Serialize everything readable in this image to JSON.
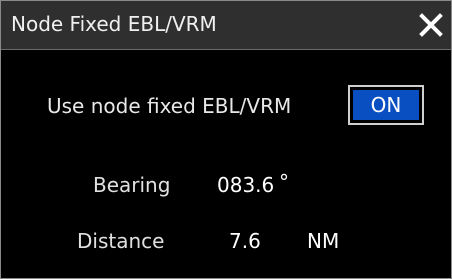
{
  "dialog": {
    "title": "Node Fixed EBL/VRM",
    "close_icon": "close-icon"
  },
  "option": {
    "label": "Use node fixed EBL/VRM",
    "toggle_label": "ON",
    "toggle_color": "#0a4fc2"
  },
  "bearing": {
    "label": "Bearing",
    "value": "083.6",
    "unit": "°"
  },
  "distance": {
    "label": "Distance",
    "value": "7.6",
    "unit": "NM"
  }
}
